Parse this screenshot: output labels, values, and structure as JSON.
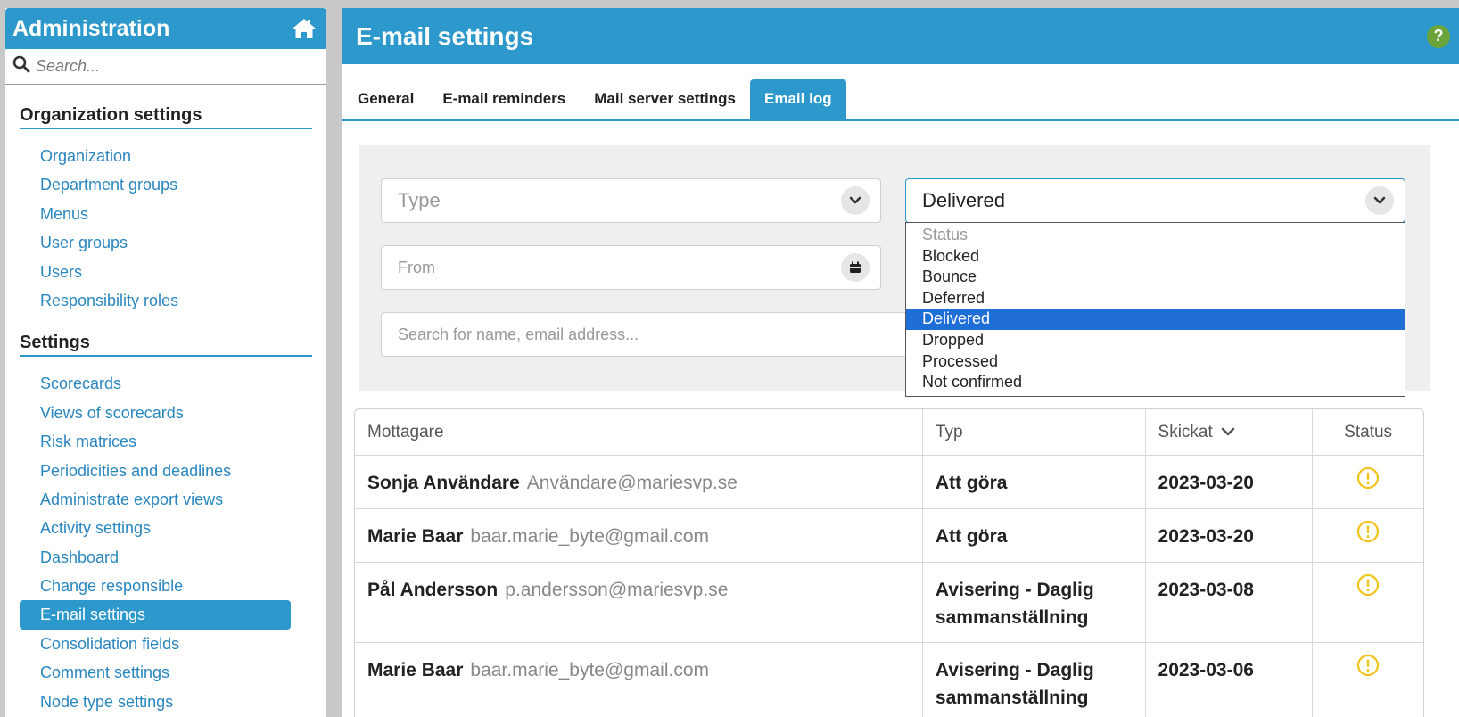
{
  "sidebar": {
    "title": "Administration",
    "search_placeholder": "Search...",
    "sections": [
      {
        "title": "Organization settings",
        "items": [
          "Organization",
          "Department groups",
          "Menus",
          "User groups",
          "Users",
          "Responsibility roles"
        ]
      },
      {
        "title": "Settings",
        "items": [
          "Scorecards",
          "Views of scorecards",
          "Risk matrices",
          "Periodicities and deadlines",
          "Administrate export views",
          "Activity settings",
          "Dashboard",
          "Change responsible",
          "E-mail settings",
          "Consolidation fields",
          "Comment settings",
          "Node type settings"
        ]
      }
    ],
    "active_item": "E-mail settings"
  },
  "main": {
    "title": "E-mail settings",
    "help_label": "?",
    "tabs": [
      "General",
      "E-mail reminders",
      "Mail server settings",
      "Email log"
    ],
    "active_tab": "Email log"
  },
  "filters": {
    "type_placeholder": "Type",
    "status_value": "Delivered",
    "from_placeholder": "From",
    "search_placeholder": "Search for name, email address...",
    "status_options": [
      "Status",
      "Blocked",
      "Bounce",
      "Deferred",
      "Delivered",
      "Dropped",
      "Processed",
      "Not confirmed"
    ]
  },
  "table": {
    "headers": [
      "Mottagare",
      "Typ",
      "Skickat",
      "Status"
    ],
    "rows": [
      {
        "name": "Sonja Användare",
        "email": "Användare@mariesvp.se",
        "type": "Att göra",
        "sent": "2023-03-20",
        "status": "warning"
      },
      {
        "name": "Marie Baar",
        "email": "baar.marie_byte@gmail.com",
        "type": "Att göra",
        "sent": "2023-03-20",
        "status": "warning"
      },
      {
        "name": "Pål Andersson",
        "email": "p.andersson@mariesvp.se",
        "type": "Avisering - Daglig sammanställning",
        "sent": "2023-03-08",
        "status": "warning"
      },
      {
        "name": "Marie Baar",
        "email": "baar.marie_byte@gmail.com",
        "type": "Avisering - Daglig sammanställning",
        "sent": "2023-03-06",
        "status": "warning"
      }
    ]
  },
  "colors": {
    "primary": "#2c98cb",
    "help": "#6aa43a",
    "selected_option": "#1f6fd6",
    "warning": "#f0c419"
  }
}
